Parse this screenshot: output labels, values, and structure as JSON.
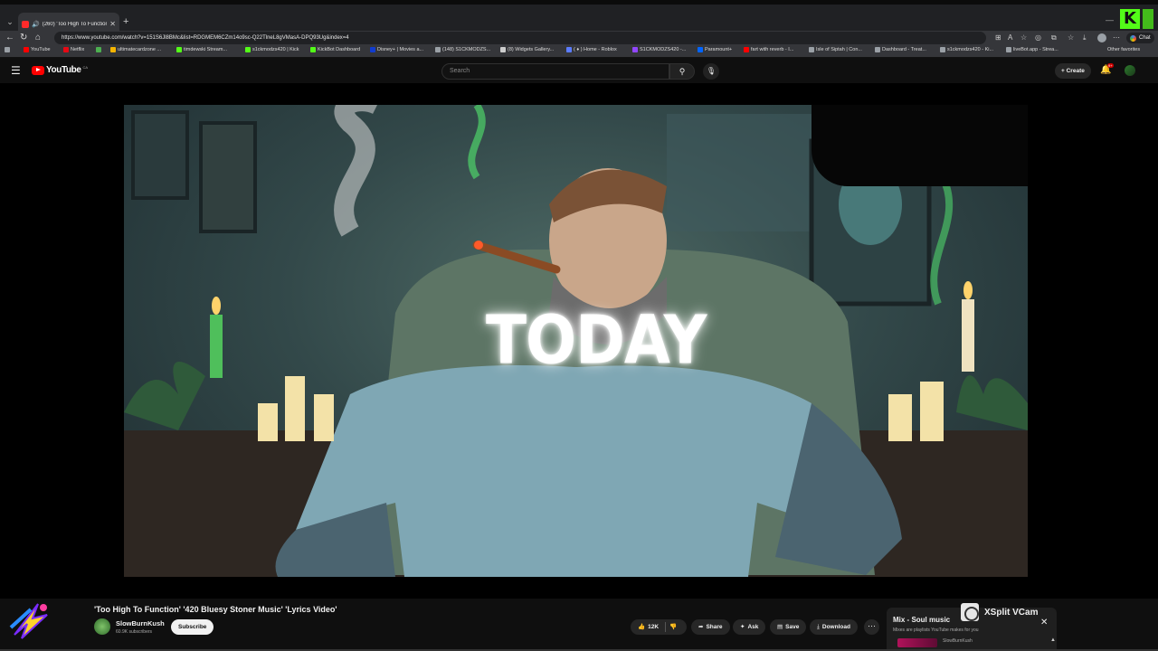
{
  "browser": {
    "tab_title": "(260) 'Too High To Function' '420 Bluesy Stoner Music' 'Lyrics Video' - YouTube",
    "url": "https://www.youtube.com/watch?v=151S6Jl8BMc&list=RDGMEM6CZm14o9sc-Q22TlneL8gVMasA-DPQ93Ug&index=4",
    "chat_label": "Chat",
    "bookmarks": [
      "YouTube",
      "Netflix",
      "",
      "ultimatecardzone ...",
      "timdewski Stream...",
      "s1ckmodzs420 | Kick",
      "KickBot Dashboard",
      "Disney+ | Movies a...",
      "(148) S1CKMODZS...",
      "(8) Widgets Gallery...",
      "( ♦ ) Home - Roblox",
      "S1CKMODZS420 -...",
      "Paramount+",
      "fart with reverb - I...",
      "Isle of Siptah | Con...",
      "Dashboard - Treat...",
      "s1ckmodzs420 - Ki...",
      "liveBot.app - Strea..."
    ],
    "other_favorites": "Other favorites"
  },
  "youtube": {
    "logo_text": "YouTube",
    "country": "CA",
    "search_placeholder": "Search",
    "create_label": "Create",
    "notif_count": "9+"
  },
  "video": {
    "caption": "TODAY",
    "title": "'Too High To Function' '420 Bluesy Stoner Music' 'Lyrics Video'",
    "channel": "SlowBurnKush",
    "subscribers": "60.9K subscribers",
    "subscribe_label": "Subscribe",
    "likes": "12K",
    "share_label": "Share",
    "ask_label": "Ask",
    "save_label": "Save",
    "download_label": "Download"
  },
  "mix": {
    "title": "Mix - Soul music",
    "subtitle": "Mixes are playlists YouTube makes for you",
    "item_channel": "SlowBurnKush"
  },
  "overlay": {
    "xsplit_label": "XSplit VCam"
  },
  "colors": {
    "youtube_red": "#ff0000",
    "kick_green": "#53fc18",
    "background": "#0f0f0f"
  }
}
